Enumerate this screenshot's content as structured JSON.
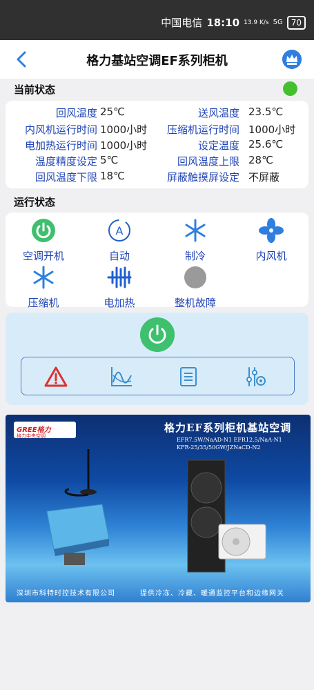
{
  "status_bar": {
    "carrier": "中国电信",
    "time": "18:10",
    "speed": "13.9 K/s",
    "network": "5G",
    "battery": "70"
  },
  "header": {
    "title": "格力基站空调EF系列柜机",
    "back_icon": "chevron-left-icon",
    "crown_icon": "crown-icon"
  },
  "current_status": {
    "label": "当前状态",
    "indicator_color": "#44c02f",
    "rows": [
      {
        "k1": "回风温度",
        "v1": "25℃",
        "k2": "送风温度",
        "v2": "23.5℃"
      },
      {
        "k1": "内风机运行时间",
        "v1": "1000小时",
        "k2": "压缩机运行时间",
        "v2": "1000小时"
      },
      {
        "k1": "电加热运行时间",
        "v1": "1000小时",
        "k2": "设定温度",
        "v2": "25.6℃"
      },
      {
        "k1": "温度精度设定",
        "v1": "5℃",
        "k2": "回风温度上限",
        "v2": "28℃"
      },
      {
        "k1": "回风温度下限",
        "v1": "18℃",
        "k2": "屏蔽触摸屏设定",
        "v2": "不屏蔽"
      }
    ]
  },
  "run_status": {
    "label": "运行状态",
    "items": [
      {
        "label": "空调开机",
        "icon": "power-on-icon"
      },
      {
        "label": "自动",
        "icon": "auto-mode-icon"
      },
      {
        "label": "制冷",
        "icon": "snowflake-icon"
      },
      {
        "label": "内风机",
        "icon": "fan-icon"
      },
      {
        "label": "压缩机",
        "icon": "snowflake-icon"
      },
      {
        "label": "电加热",
        "icon": "heater-icon"
      },
      {
        "label": "整机故障",
        "icon": "fault-indicator-icon"
      }
    ]
  },
  "controls": {
    "power_icon": "power-icon",
    "tools": [
      "alarm-icon",
      "chart-icon",
      "list-icon",
      "settings-sliders-icon"
    ]
  },
  "banner": {
    "brand": "GREE格力",
    "brand_sub": "格力中央空调",
    "title": "格力EF系列柜机基站空调",
    "models_1": "EFR7.5W/NaAD-N1 EFR12.5/NaA-N1",
    "models_2": "KFR-25/35/50GW/JZNaCD-N2",
    "footer_left": "深圳市科特时控技术有限公司",
    "footer_right": "提供冷冻、冷藏、暖通监控平台和边缘网关"
  }
}
